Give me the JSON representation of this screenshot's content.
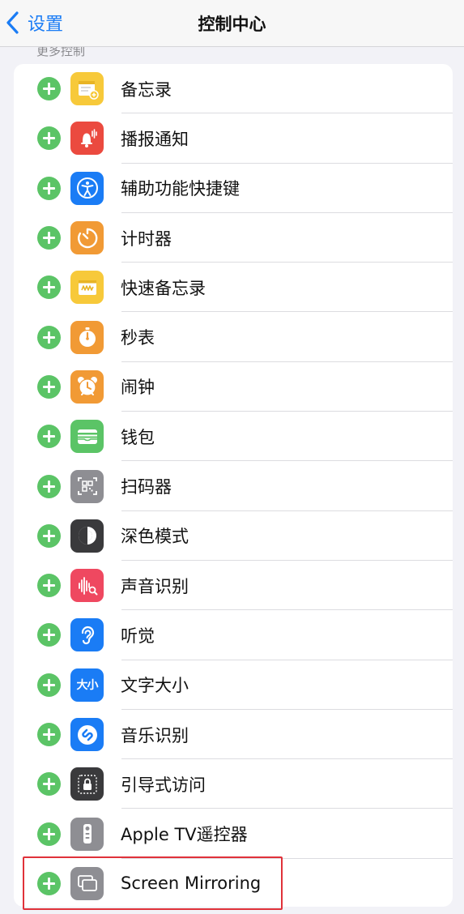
{
  "navbar": {
    "back_label": "设置",
    "title": "控制中心"
  },
  "section_header": "更多控制",
  "rows": [
    {
      "label": "备忘录",
      "icon": "notes-icon",
      "color": "#f7c93a"
    },
    {
      "label": "播报通知",
      "icon": "bell-wave-icon",
      "color": "#eb4a3f"
    },
    {
      "label": "辅助功能快捷键",
      "icon": "accessibility-icon",
      "color": "#1a7cf5"
    },
    {
      "label": "计时器",
      "icon": "timer-icon",
      "color": "#f19a35"
    },
    {
      "label": "快速备忘录",
      "icon": "quick-note-icon",
      "color": "#f7c93a"
    },
    {
      "label": "秒表",
      "icon": "stopwatch-icon",
      "color": "#f19a35"
    },
    {
      "label": "闹钟",
      "icon": "alarm-clock-icon",
      "color": "#f19a35"
    },
    {
      "label": "钱包",
      "icon": "wallet-icon",
      "color": "#5bc466"
    },
    {
      "label": "扫码器",
      "icon": "qr-scanner-icon",
      "color": "#8e8e93"
    },
    {
      "label": "深色模式",
      "icon": "dark-mode-icon",
      "color": "#3a3a3c"
    },
    {
      "label": "声音识别",
      "icon": "sound-recognition-icon",
      "color": "#ef4860"
    },
    {
      "label": "听觉",
      "icon": "ear-icon",
      "color": "#1a7cf5"
    },
    {
      "label": "文字大小",
      "icon": "text-size-icon",
      "color": "#1a7cf5"
    },
    {
      "label": "音乐识别",
      "icon": "shazam-icon",
      "color": "#1a7cf5"
    },
    {
      "label": "引导式访问",
      "icon": "lock-icon",
      "color": "#3a3a3c"
    },
    {
      "label": "Apple TV遥控器",
      "icon": "tv-remote-icon",
      "color": "#8e8e93"
    },
    {
      "label": "Screen Mirroring",
      "icon": "screen-mirroring-icon",
      "color": "#8e8e93"
    }
  ],
  "icon_text": {
    "text_size": "大小"
  },
  "colors": {
    "accent": "#1a7cf5",
    "add_green": "#5bc466",
    "highlight_red": "#e0323a"
  }
}
